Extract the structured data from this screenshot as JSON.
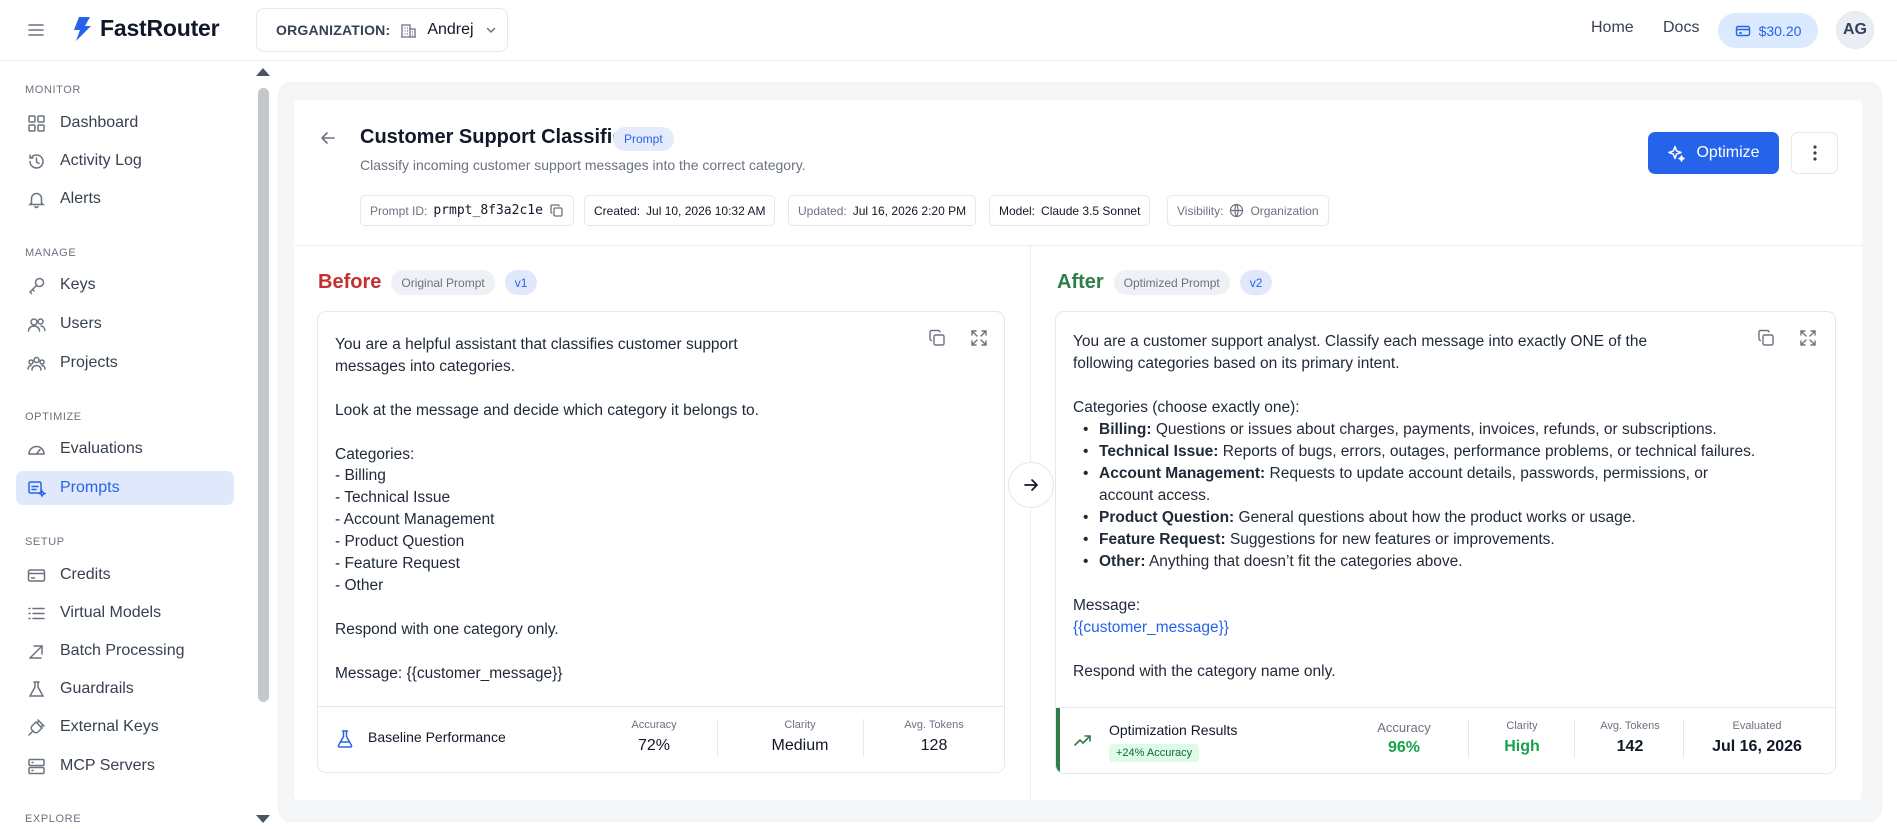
{
  "app": {
    "brand": "FastRouter",
    "org_label": "ORGANIZATION:",
    "org_value": "Andrej",
    "nav": {
      "home": "Home",
      "docs": "Docs"
    },
    "credits": "$30.20",
    "avatar_initials": "AG"
  },
  "sidebar": {
    "sections": [
      {
        "title": "MONITOR",
        "items": [
          {
            "label": "Dashboard",
            "icon": "grid-icon"
          },
          {
            "label": "Activity Log",
            "icon": "history-icon"
          },
          {
            "label": "Alerts",
            "icon": "bell-icon"
          }
        ]
      },
      {
        "title": "MANAGE",
        "items": [
          {
            "label": "Keys",
            "icon": "key-icon"
          },
          {
            "label": "Users",
            "icon": "users-icon"
          },
          {
            "label": "Projects",
            "icon": "projects-icon"
          }
        ]
      },
      {
        "title": "OPTIMIZE",
        "items": [
          {
            "label": "Evaluations",
            "icon": "gauge-icon"
          },
          {
            "label": "Prompts",
            "icon": "prompt-icon",
            "active": true
          }
        ]
      },
      {
        "title": "SETUP",
        "items": [
          {
            "label": "Credits",
            "icon": "credit-card-icon"
          },
          {
            "label": "Virtual Models",
            "icon": "list-icon"
          },
          {
            "label": "Batch Processing",
            "icon": "batch-icon"
          },
          {
            "label": "Guardrails",
            "icon": "flask-icon"
          },
          {
            "label": "External Keys",
            "icon": "plug-icon"
          },
          {
            "label": "MCP Servers",
            "icon": "server-icon"
          }
        ]
      },
      {
        "title": "EXPLORE",
        "items": []
      }
    ]
  },
  "header": {
    "title": "Customer Support Classifier",
    "badge": "Prompt",
    "subtitle": "Classify incoming customer support messages into the correct category.",
    "optimize_label": "Optimize",
    "meta": {
      "prompt_id_label": "Prompt ID:",
      "prompt_id": "prmpt_8f3a2c1e",
      "created_label": "Created:",
      "created": "Jul 10, 2026 10:32 AM",
      "updated_label": "Updated:",
      "updated": "Jul 16, 2026 2:20 PM",
      "model_label": "Model:",
      "model": "Claude 3.5 Sonnet",
      "visibility_label": "Visibility:",
      "visibility": "Organization"
    }
  },
  "before": {
    "label": "Before",
    "tag": "Original Prompt",
    "version": "v1",
    "text": "You are a helpful assistant that classifies customer support\nmessages into categories.\n\nLook at the message and decide which category it belongs to.\n\nCategories:\n- Billing\n- Technical Issue\n- Account Management\n- Product Question\n- Feature Request\n- Other\n\nRespond with one category only.\n\nMessage: {{customer_message}}",
    "footer": {
      "title": "Baseline Performance",
      "stats": [
        {
          "label": "Accuracy",
          "value": "72%"
        },
        {
          "label": "Clarity",
          "value": "Medium"
        },
        {
          "label": "Avg. Tokens",
          "value": "128"
        }
      ]
    }
  },
  "after": {
    "label": "After",
    "tag": "Optimized Prompt",
    "version": "v2",
    "intro_1": "You are a customer support analyst. Classify each message into exactly ONE of the",
    "intro_2": "following categories based on its primary intent.",
    "categories_heading": "Categories (choose exactly one):",
    "categories": [
      {
        "name": "Billing:",
        "desc": "Questions or issues about charges, payments, invoices, refunds, or subscriptions."
      },
      {
        "name": "Technical Issue:",
        "desc": "Reports of bugs, errors, outages, performance problems, or technical failures."
      },
      {
        "name": "Account Management:",
        "desc": "Requests to update account details, passwords, permissions, or account access."
      },
      {
        "name": "Product Question:",
        "desc": "General questions about how the product works or usage."
      },
      {
        "name": "Feature Request:",
        "desc": "Suggestions for new features or improvements."
      },
      {
        "name": "Other:",
        "desc": "Anything that doesn’t fit the categories above."
      }
    ],
    "message_label": "Message:",
    "message_var": "{{customer_message}}",
    "closing": "Respond with the category name only.",
    "footer": {
      "title": "Optimization Results",
      "gain": "+24% Accuracy",
      "stats": [
        {
          "label": "Accuracy",
          "value": "96%"
        },
        {
          "label": "Clarity",
          "value": "High"
        },
        {
          "label": "Avg. Tokens",
          "value": "142"
        },
        {
          "label": "Evaluated",
          "value": "Jul 16, 2026"
        }
      ]
    }
  },
  "colors": {
    "accent": "#2563eb",
    "before": "#c2302f",
    "after": "#2e7d4a",
    "success": "#16a34a"
  }
}
